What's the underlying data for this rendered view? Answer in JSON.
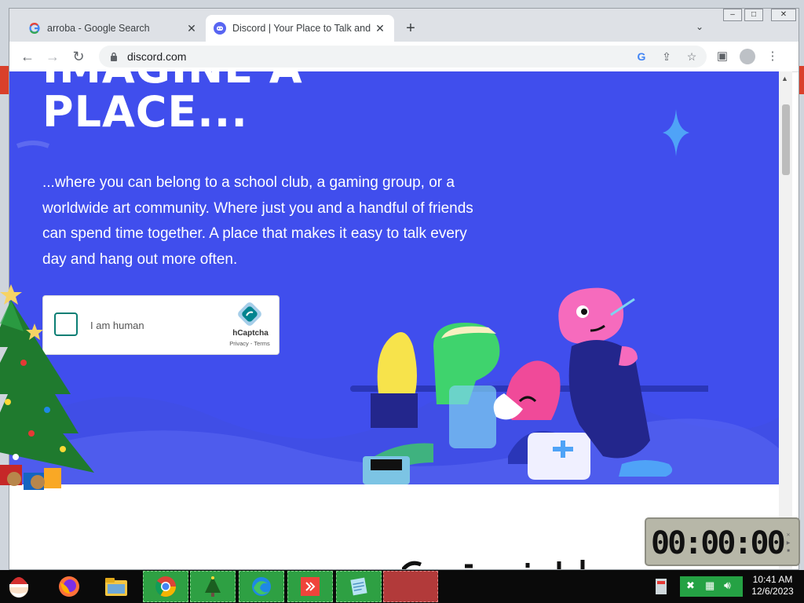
{
  "browser": {
    "tabs": [
      {
        "title": "arroba - Google Search",
        "favicon": "google-g-icon",
        "active": false
      },
      {
        "title": "Discord | Your Place to Talk and H",
        "favicon": "discord-icon",
        "active": true
      }
    ],
    "address": "discord.com"
  },
  "page": {
    "headline_line1": "IMAGINE A",
    "headline_line2": "PLACE...",
    "lead": "...where you can belong to a school club, a gaming group, or a worldwide art community. Where just you and a handful of friends can spend time together. A place that makes it easy to talk every day and hang out more often.",
    "captcha": {
      "label": "I am human",
      "brand": "hCaptcha",
      "links": "Privacy - Terms"
    }
  },
  "gadget": {
    "stopwatch_time": "00:00:00"
  },
  "taskbar": {
    "clock_time": "10:41 AM",
    "clock_date": "12/6/2023"
  },
  "colors": {
    "hero_bg": "#404eed",
    "captcha_accent": "#0b7e74"
  }
}
